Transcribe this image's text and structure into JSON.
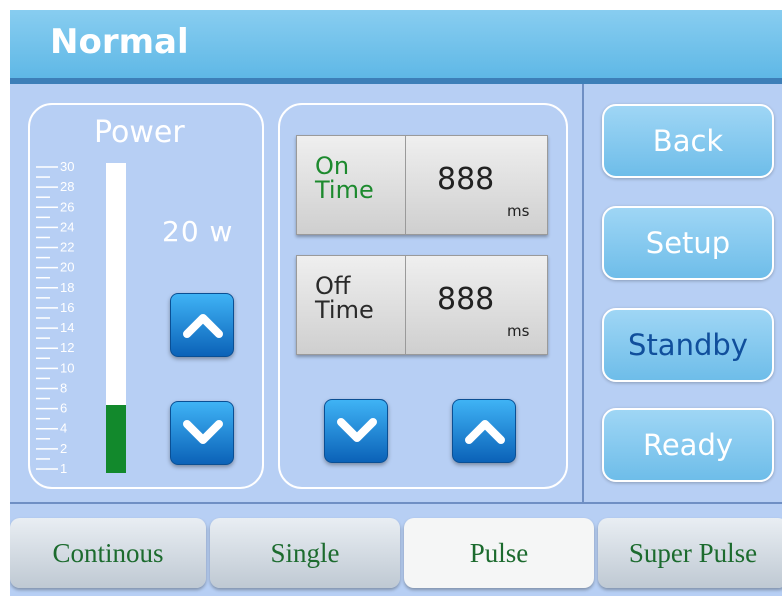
{
  "header": {
    "title": "Normal"
  },
  "power": {
    "title": "Power",
    "value": "20 w",
    "scale_labels": [
      "30",
      "28",
      "26",
      "24",
      "22",
      "20",
      "18",
      "16",
      "14",
      "12",
      "10",
      "8",
      "6",
      "4",
      "2",
      "1"
    ],
    "level_fraction": 0.22
  },
  "on_time": {
    "label_line1": "On",
    "label_line2": "Time",
    "value": "888",
    "unit": "ms"
  },
  "off_time": {
    "label_line1": "Off",
    "label_line2": "Time",
    "value": "888",
    "unit": "ms"
  },
  "side_buttons": {
    "back": "Back",
    "setup": "Setup",
    "standby": "Standby",
    "ready": "Ready"
  },
  "tabs": {
    "continuous": "Continous",
    "single": "Single",
    "pulse": "Pulse",
    "super_pulse": "Super Pulse"
  },
  "colors": {
    "background": "#b7cff4",
    "header": "#6cc0ea",
    "power_fill": "#12892c",
    "on_label": "#1d8a2e",
    "tab_text": "#1c6b2e",
    "standby_text": "#114f9c"
  },
  "icons": {
    "up": "chevron-up-icon",
    "down": "chevron-down-icon"
  }
}
